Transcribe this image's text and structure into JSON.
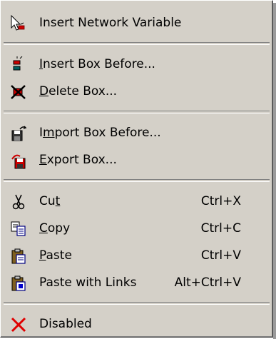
{
  "menu": {
    "groups": [
      {
        "items": [
          {
            "label": "Insert Network Variable",
            "icon": "cursor-network-icon",
            "shortcut": ""
          }
        ]
      },
      {
        "items": [
          {
            "label": "Insert Box Before...",
            "mnemonic": "I",
            "rest": "nsert Box Before...",
            "icon": "insert-box-icon",
            "shortcut": ""
          },
          {
            "label": "Delete Box...",
            "mnemonic": "D",
            "rest": "elete Box...",
            "icon": "delete-box-icon",
            "shortcut": ""
          }
        ]
      },
      {
        "items": [
          {
            "label": "Import Box Before...",
            "pre": "I",
            "mnemonic": "m",
            "rest": "port Box Before...",
            "icon": "import-box-icon",
            "shortcut": ""
          },
          {
            "label": "Export Box...",
            "mnemonic": "E",
            "rest": "xport Box...",
            "icon": "export-box-icon",
            "shortcut": ""
          }
        ]
      },
      {
        "items": [
          {
            "label": "Cut",
            "pre": "Cu",
            "mnemonic": "t",
            "rest": "",
            "icon": "scissors-icon",
            "shortcut": "Ctrl+X"
          },
          {
            "label": "Copy",
            "mnemonic": "C",
            "rest": "opy",
            "icon": "copy-icon",
            "shortcut": "Ctrl+C"
          },
          {
            "label": "Paste",
            "mnemonic": "P",
            "rest": "aste",
            "icon": "paste-icon",
            "shortcut": "Ctrl+V"
          },
          {
            "label": "Paste with Links",
            "icon": "paste-links-icon",
            "shortcut": "Alt+Ctrl+V"
          }
        ]
      },
      {
        "items": [
          {
            "label": "Disabled",
            "icon": "red-x-icon",
            "shortcut": ""
          }
        ]
      }
    ]
  }
}
